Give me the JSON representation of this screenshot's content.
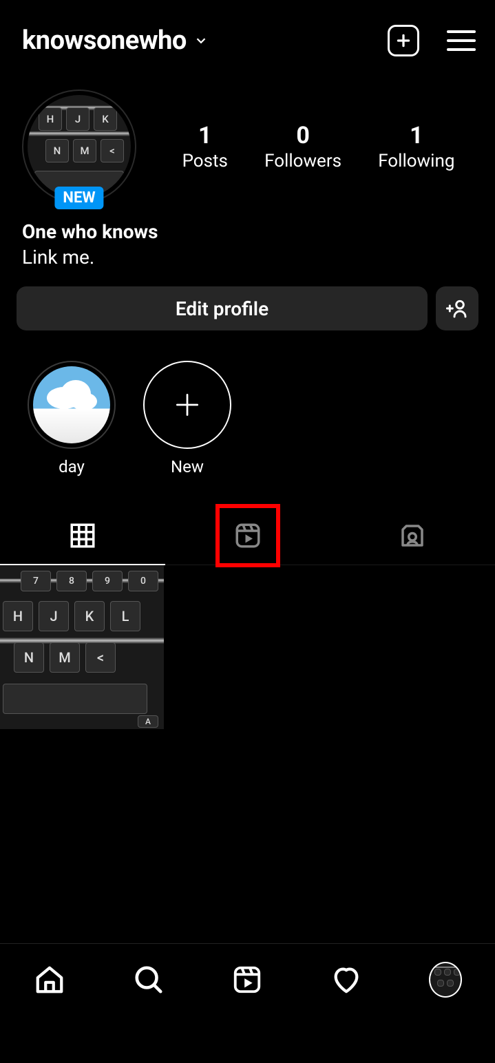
{
  "header": {
    "username": "knowsonewho"
  },
  "profile": {
    "new_badge": "NEW",
    "stats": {
      "posts": {
        "count": "1",
        "label": "Posts"
      },
      "followers": {
        "count": "0",
        "label": "Followers"
      },
      "following": {
        "count": "1",
        "label": "Following"
      }
    },
    "display_name": "One who knows",
    "bio": "Link me."
  },
  "actions": {
    "edit_profile": "Edit profile"
  },
  "highlights": [
    {
      "label": "day"
    },
    {
      "label": "New"
    }
  ],
  "tabs": {
    "active": "grid",
    "highlighted": "reels"
  }
}
